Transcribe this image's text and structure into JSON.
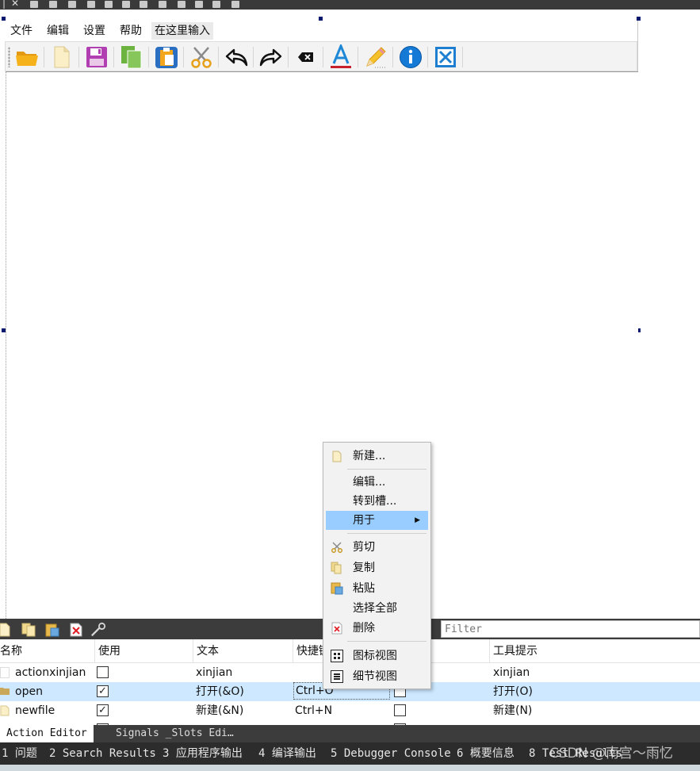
{
  "menubar": {
    "items": [
      "文件",
      "编辑",
      "设置",
      "帮助"
    ],
    "type_here": "在这里输入"
  },
  "toolbar": {
    "icons": [
      "open-folder-icon",
      "new-file-icon",
      "save-icon",
      "copy-icon",
      "paste-icon",
      "cut-icon",
      "undo-icon",
      "redo-icon",
      "delete-icon",
      "font-color-icon",
      "pencil-icon",
      "info-icon",
      "close-icon"
    ]
  },
  "context_menu": {
    "new": "新建...",
    "edit": "编辑...",
    "goto_slot": "转到槽...",
    "use_for": "用于",
    "cut": "剪切",
    "copy": "复制",
    "paste": "粘贴",
    "select_all": "选择全部",
    "delete": "删除",
    "icon_view": "图标视图",
    "detail_view": "细节视图"
  },
  "action_editor": {
    "filter_placeholder": "Filter",
    "columns": [
      "名称",
      "使用",
      "文本",
      "快捷键",
      "",
      "工具提示"
    ],
    "rows": [
      {
        "name": "actionxinjian",
        "used": false,
        "text": "xinjian",
        "shortcut": "",
        "checkable": false,
        "tooltip": "xinjian"
      },
      {
        "name": "open",
        "used": true,
        "text": "打开(&O)",
        "shortcut": "Ctrl+O",
        "checkable": false,
        "tooltip": "打开(O)"
      },
      {
        "name": "newfile",
        "used": true,
        "text": "新建(&N)",
        "shortcut": "Ctrl+N",
        "checkable": false,
        "tooltip": "新建(N)"
      }
    ]
  },
  "tabs": {
    "action_editor": "Action Editor",
    "signals_slots": "Signals _Slots Edi…"
  },
  "output_panes": [
    "1 问题",
    "2 Search Results",
    "3 应用程序输出",
    "4 编译输出",
    "5 Debugger Console",
    "6 概要信息",
    "8 Test Results"
  ],
  "watermark": "CSDN @南宫～雨忆",
  "colors": {
    "selection": "#99ccff",
    "row_selected": "#cde8ff",
    "handle": "#0a1a6e",
    "dark_panel": "#3c3c3c"
  }
}
